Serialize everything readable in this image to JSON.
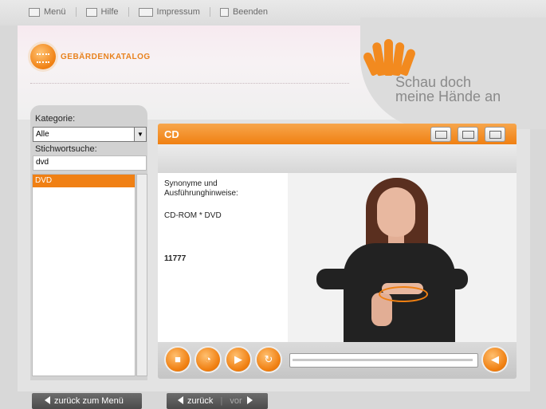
{
  "topnav": {
    "menu": "Menü",
    "help": "Hilfe",
    "imprint": "Impressum",
    "quit": "Beenden"
  },
  "header": {
    "logo_text": "GEBÄRDENKATALOG",
    "slogan_line1": "Schau doch",
    "slogan_line2": "meine Hände an"
  },
  "sidebar": {
    "category_label": "Kategorie:",
    "category_value": "Alle",
    "search_label": "Stichwortsuche:",
    "search_value": "dvd",
    "results": [
      "DVD"
    ]
  },
  "content": {
    "title": "CD",
    "synonyms_label_line1": "Synonyme und",
    "synonyms_label_line2": "Ausführunghinweise:",
    "synonyms_value": "CD-ROM * DVD",
    "id_number": "11777"
  },
  "footer": {
    "back_to_menu": "zurück zum Menü",
    "back": "zurück",
    "forward": "vor"
  },
  "colors": {
    "accent": "#f08012",
    "brand_gray": "#8a8a8a"
  }
}
